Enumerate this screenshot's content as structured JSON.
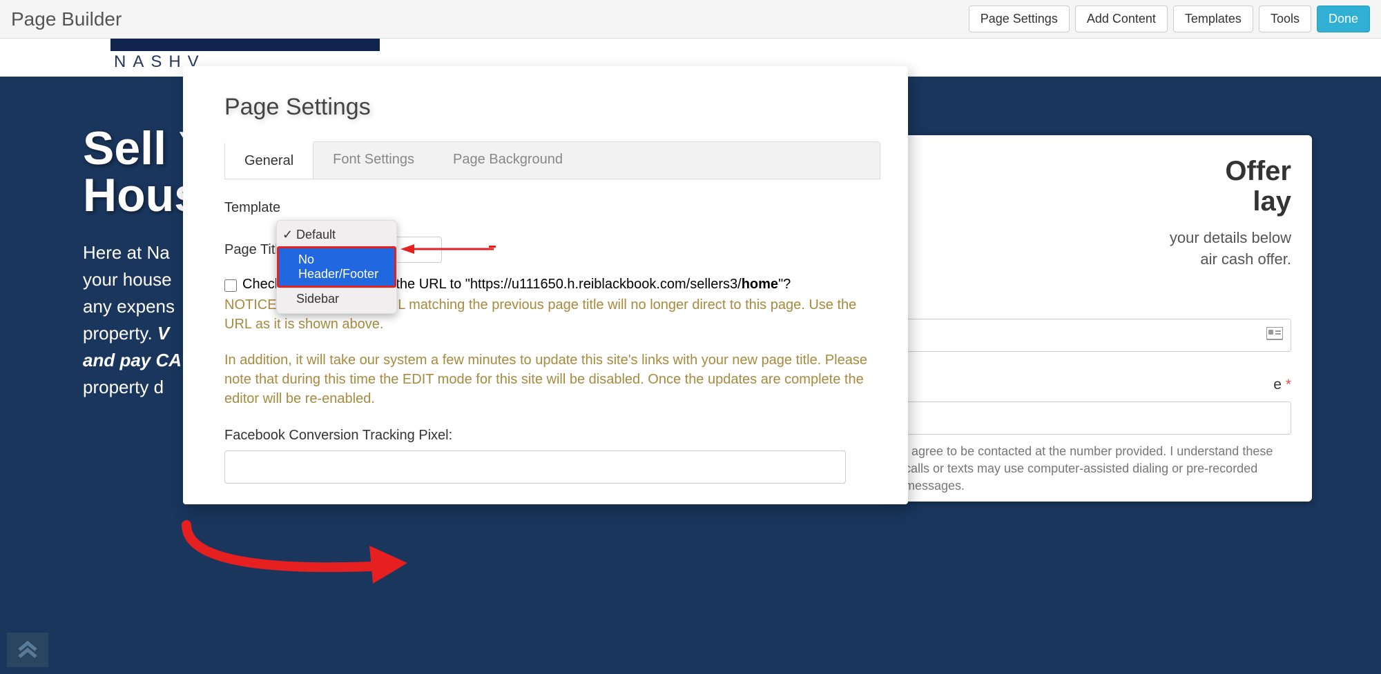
{
  "toolbar": {
    "title": "Page Builder",
    "buttons": {
      "page_settings": "Page Settings",
      "add_content": "Add Content",
      "templates": "Templates",
      "tools": "Tools",
      "done": "Done"
    }
  },
  "logo": {
    "text": "NASHV"
  },
  "hero": {
    "title1": "Sell Y",
    "title2": "Hous",
    "body1": "Here at Na",
    "body2": "your house",
    "body3": "any expens",
    "body4": "property. ",
    "body5": "and pay C",
    "body6": "property d"
  },
  "offer": {
    "title1": "Offer",
    "title2": "lay",
    "sub1": "your details below",
    "sub2": "air cash offer.",
    "required_suffix": "e ",
    "consent": "I agree to be contacted at the number provided. I understand these calls or texts may use computer-assisted dialing or pre-recorded messages."
  },
  "modal": {
    "title": "Page Settings",
    "tabs": {
      "general": "General",
      "font": "Font Settings",
      "background": "Page Background"
    },
    "template_label": "Template",
    "page_title_label": "Page Title",
    "dropdown": {
      "default": "Default",
      "no_header": "No Header/Footer",
      "sidebar": "Sidebar"
    },
    "checkbox_text_prefix": "Check the box to update the URL to \"https://u111650.h.reiblackbook.com/sellers3/",
    "checkbox_text_bold": "home",
    "checkbox_text_suffix": "\"?",
    "notice1": "NOTICE: If checked, the URL matching the previous page title will no longer direct to this page. Use the URL as it is shown above.",
    "notice2": "In addition, it will take our system a few minutes to update this site's links with your new page title. Please note that during this time the EDIT mode for this site will be disabled. Once the updates are complete the editor will be re-enabled.",
    "fb_label": "Facebook Conversion Tracking Pixel:"
  }
}
